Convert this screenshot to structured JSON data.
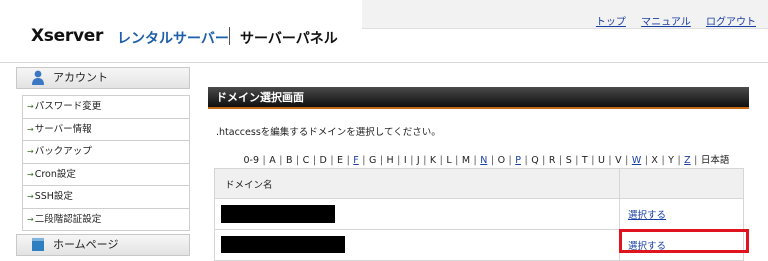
{
  "header": {
    "logo_main": "Xserver",
    "logo_sub": "レンタルサーバー",
    "panel_title": "サーバーパネル",
    "links": [
      "トップ",
      "マニュアル",
      "ログアウト"
    ]
  },
  "sidebar": {
    "account_title": "アカウント",
    "account_items": [
      "パスワード変更",
      "サーバー情報",
      "バックアップ",
      "Cron設定",
      "SSH設定",
      "二段階認証設定"
    ],
    "homepage_title": "ホームページ",
    "arrow_glyph": "→"
  },
  "main": {
    "title": "ドメイン選択画面",
    "instruction": ".htaccessを編集するドメインを選択してください。",
    "alphabet": [
      {
        "text": "0-9",
        "link": false
      },
      {
        "text": "A",
        "link": false
      },
      {
        "text": "B",
        "link": false
      },
      {
        "text": "C",
        "link": false
      },
      {
        "text": "D",
        "link": false
      },
      {
        "text": "E",
        "link": false
      },
      {
        "text": "F",
        "link": true
      },
      {
        "text": "G",
        "link": false
      },
      {
        "text": "H",
        "link": false
      },
      {
        "text": "I",
        "link": false
      },
      {
        "text": "J",
        "link": false
      },
      {
        "text": "K",
        "link": false
      },
      {
        "text": "L",
        "link": false
      },
      {
        "text": "M",
        "link": false
      },
      {
        "text": "N",
        "link": true
      },
      {
        "text": "O",
        "link": false
      },
      {
        "text": "P",
        "link": true
      },
      {
        "text": "Q",
        "link": false
      },
      {
        "text": "R",
        "link": false
      },
      {
        "text": "S",
        "link": false
      },
      {
        "text": "T",
        "link": false
      },
      {
        "text": "U",
        "link": false
      },
      {
        "text": "V",
        "link": false
      },
      {
        "text": "W",
        "link": true
      },
      {
        "text": "X",
        "link": false
      },
      {
        "text": "Y",
        "link": false
      },
      {
        "text": "Z",
        "link": true
      },
      {
        "text": "日本語",
        "link": false
      }
    ],
    "table": {
      "header_name": "ドメイン名",
      "header_action": "",
      "rows": [
        {
          "domain": "",
          "action": "選択する"
        },
        {
          "domain": "",
          "action": "選択する"
        }
      ]
    }
  },
  "colors": {
    "link": "#1a3fa3",
    "brand_blue": "#1d5fa8",
    "highlight": "#e0141e",
    "title_accent": "#c46a18"
  }
}
